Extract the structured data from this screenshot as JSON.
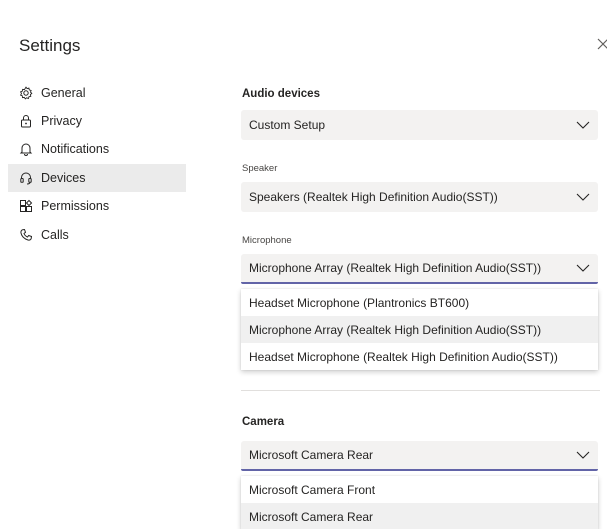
{
  "dialog": {
    "title": "Settings"
  },
  "nav": {
    "items": [
      {
        "label": "General",
        "icon": "gear-icon"
      },
      {
        "label": "Privacy",
        "icon": "lock-icon"
      },
      {
        "label": "Notifications",
        "icon": "bell-icon"
      },
      {
        "label": "Devices",
        "icon": "headset-icon",
        "active": true
      },
      {
        "label": "Permissions",
        "icon": "permissions-icon"
      },
      {
        "label": "Calls",
        "icon": "phone-icon"
      }
    ]
  },
  "audio": {
    "heading": "Audio devices",
    "setup_value": "Custom Setup",
    "speaker_label": "Speaker",
    "speaker_value": "Speakers (Realtek High Definition Audio(SST))",
    "microphone_label": "Microphone",
    "microphone_value": "Microphone Array (Realtek High Definition Audio(SST))",
    "microphone_options": [
      "Headset Microphone (Plantronics BT600)",
      "Microphone Array (Realtek High Definition Audio(SST))",
      "Headset Microphone (Realtek High Definition Audio(SST))"
    ]
  },
  "camera": {
    "heading": "Camera",
    "value": "Microsoft Camera Rear",
    "options": [
      "Microsoft Camera Front",
      "Microsoft Camera Rear"
    ]
  },
  "colors": {
    "accent": "#6264a7",
    "selected_bg": "#ebebeb",
    "field_bg": "#f3f2f1"
  }
}
